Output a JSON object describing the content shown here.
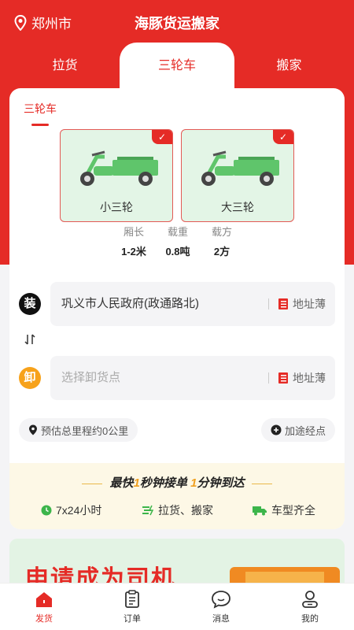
{
  "header": {
    "city": "郑州市",
    "title": "海豚货运搬家"
  },
  "tabs": [
    {
      "label": "拉货"
    },
    {
      "label": "三轮车",
      "active": true
    },
    {
      "label": "搬家"
    }
  ],
  "subtab": "三轮车",
  "vehicles": [
    {
      "label": "小三轮",
      "selected": true
    },
    {
      "label": "大三轮",
      "selected": true
    }
  ],
  "specs": [
    {
      "key": "厢长",
      "value": "1-2米"
    },
    {
      "key": "载重",
      "value": "0.8吨"
    },
    {
      "key": "载方",
      "value": "2方"
    }
  ],
  "load": {
    "badge": "装",
    "address": "巩义市人民政府(政通路北)",
    "book": "地址薄"
  },
  "unload": {
    "badge": "卸",
    "placeholder": "选择卸货点",
    "book": "地址薄"
  },
  "distance": "预估总里程约0公里",
  "waypoint": "加途经点",
  "promo": {
    "part1": "最快",
    "n1": "1",
    "part2": "秒钟接单",
    "n2": "1",
    "part3": "分钟到达",
    "features": [
      "7x24小时",
      "拉货、搬家",
      "车型齐全"
    ]
  },
  "banner": {
    "text": "申请成为司机"
  },
  "nav": [
    {
      "label": "发货",
      "active": true
    },
    {
      "label": "订单"
    },
    {
      "label": "消息"
    },
    {
      "label": "我的"
    }
  ],
  "colors": {
    "brand_red": "#e52b26",
    "vehicle_green": "#e3f5e6",
    "promo_bg": "#fdf8e6",
    "unload_orange": "#f7a21b"
  }
}
